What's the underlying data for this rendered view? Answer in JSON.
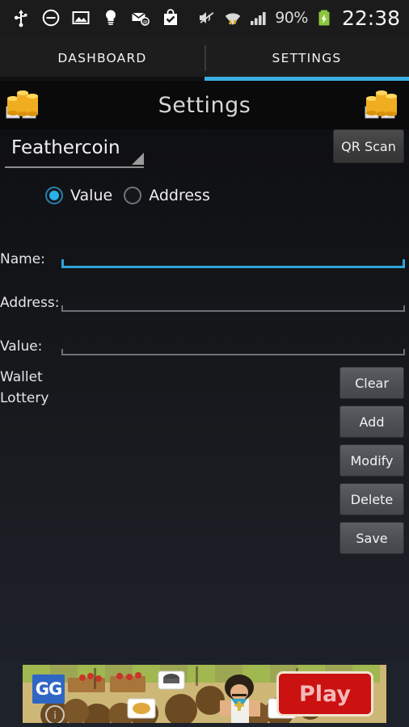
{
  "status_bar": {
    "left_icons": [
      "usb-icon",
      "do-not-disturb-icon",
      "screenshot-image-icon",
      "lightbulb-icon",
      "email-at-icon",
      "shopping-bag-check-icon"
    ],
    "right_icons": [
      "mute-vibrate-icon",
      "wifi-data-transfer-icon",
      "cellular-signal-icon"
    ],
    "battery_percent": "90%",
    "battery_state": "charging",
    "clock": "22:38"
  },
  "tabs": {
    "items": [
      {
        "label": "DASHBOARD",
        "active": false
      },
      {
        "label": "SETTINGS",
        "active": true
      }
    ],
    "active_color": "#3bafde"
  },
  "header": {
    "title": "Settings",
    "left_icon": "coin-stack-icon",
    "right_icon": "coin-stack-icon"
  },
  "spinner": {
    "selected": "Feathercoin",
    "caret": "dropdown-caret-icon"
  },
  "qr_button": {
    "label": "QR Scan"
  },
  "radio_group": {
    "options": [
      {
        "label": "Value",
        "selected": true
      },
      {
        "label": "Address",
        "selected": false
      }
    ],
    "selected_color": "#29b2ea"
  },
  "form": {
    "fields": [
      {
        "label": "Name:",
        "value": "",
        "placeholder": "",
        "focused": true
      },
      {
        "label": "Address:",
        "value": "",
        "placeholder": "",
        "focused": false
      },
      {
        "label": "Value:",
        "value": "",
        "placeholder": "",
        "focused": false
      }
    ]
  },
  "wallet_section": {
    "line1": "Wallet",
    "line2": "Lottery"
  },
  "action_buttons": [
    {
      "label": "Clear"
    },
    {
      "label": "Add"
    },
    {
      "label": "Modify"
    },
    {
      "label": "Delete"
    },
    {
      "label": "Save"
    }
  ],
  "ad_banner": {
    "logo_text": "GG",
    "cta_label": "Play"
  }
}
